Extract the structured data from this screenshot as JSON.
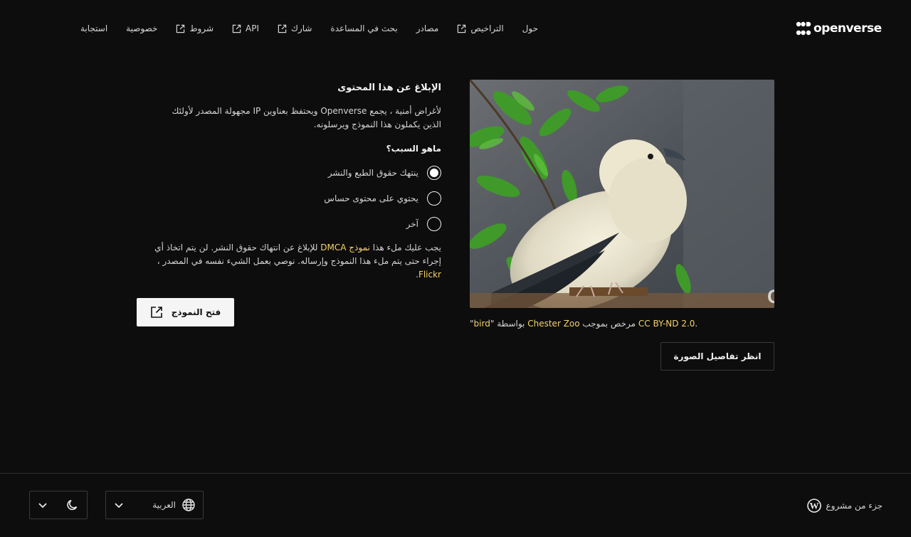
{
  "brand": {
    "name": "openverse"
  },
  "nav": {
    "items": [
      {
        "label": "حول",
        "external": false
      },
      {
        "label": "التراخيص",
        "external": true
      },
      {
        "label": "مصادر",
        "external": false
      },
      {
        "label": "بحث في المساعدة",
        "external": false
      },
      {
        "label": "شارك",
        "external": true
      },
      {
        "label": "API",
        "external": true
      },
      {
        "label": "شروط",
        "external": true
      },
      {
        "label": "خصوصية",
        "external": false
      },
      {
        "label": "استجابة",
        "external": false
      }
    ]
  },
  "media": {
    "watermark": "ChesterZoo.org",
    "attribution": {
      "open_quote": "\"",
      "title": "bird",
      "close_quote": "\"",
      "by": " بواسطة ",
      "creator": "Chester Zoo",
      "licensed": " مرخص بموجب ",
      "license": "CC BY-ND 2.0",
      "end": "."
    },
    "details_button": "انظر تفاصيل الصورة"
  },
  "report": {
    "title": "الإبلاغ عن هذا المحتوى",
    "description": "لأغراض أمنية ، يجمع Openverse ويحتفظ بعناوين IP مجهولة المصدر لأولئك الذين يكملون هذا النموذج ويرسلونه.",
    "question": "ماهو السبب؟",
    "reasons": [
      {
        "label": "ينتهك حقوق الطبع والنشر",
        "checked": true
      },
      {
        "label": "يحتوي على محتوى حساس",
        "checked": false
      },
      {
        "label": "آخر",
        "checked": false
      }
    ],
    "dmca": {
      "before": "يجب عليك ملء هذا ",
      "form_link": "نموذج",
      "dmca_link": "DMCA",
      "middle": " للإبلاغ عن انتهاك حقوق النشر. لن يتم اتخاذ أي إجراء حتى يتم ملء هذا النموذج وإرساله. نوصي بعمل الشيء نفسه في المصدر ، ",
      "source_link": "Flickr",
      "end": "."
    },
    "open_form_button": "فتح النموذج"
  },
  "footer": {
    "credit": "جزء من مشروع",
    "language": "العربية"
  },
  "colors": {
    "background": "#0d0d0d",
    "accent_link": "#f4d36b",
    "text": "#d4d4d4"
  }
}
